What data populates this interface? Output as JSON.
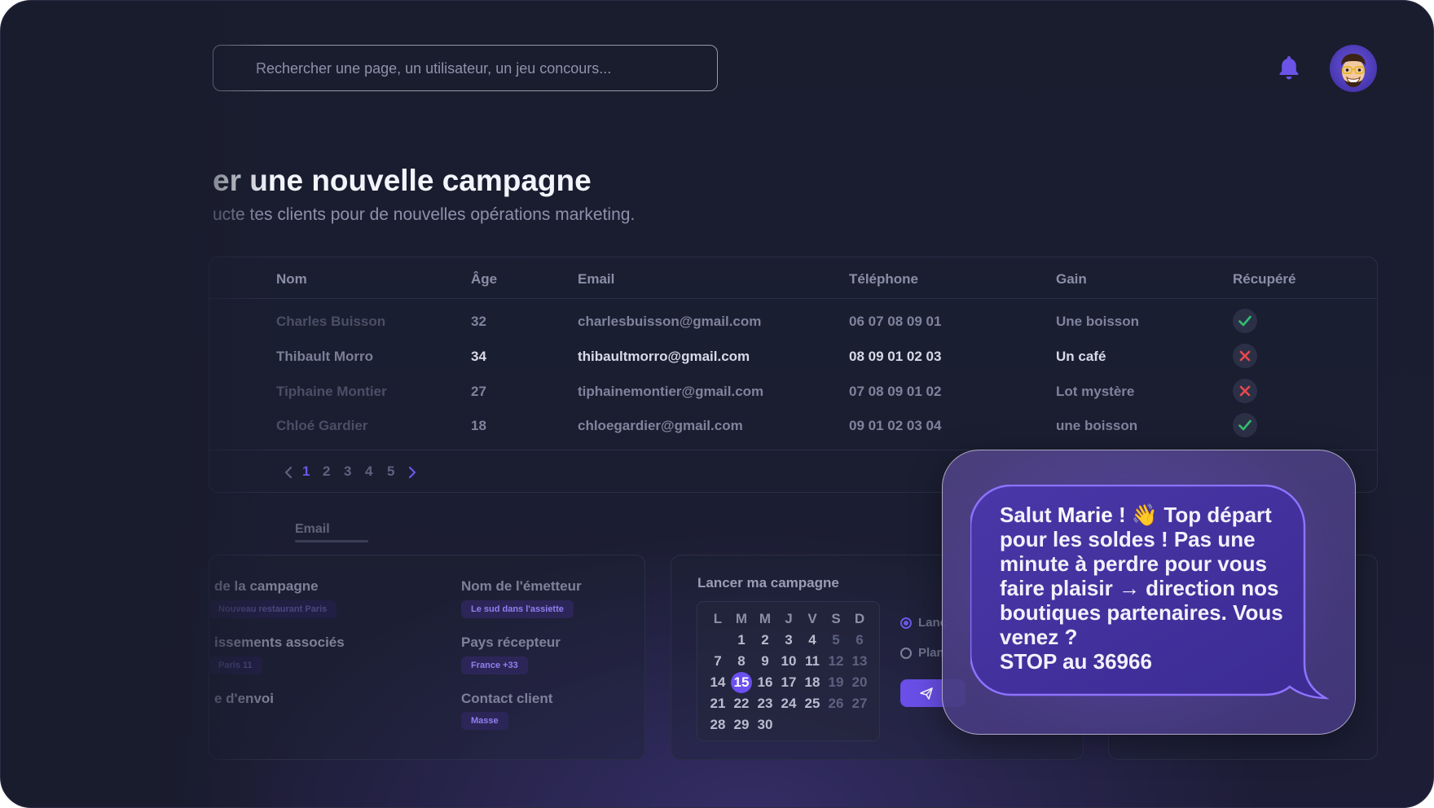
{
  "search": {
    "placeholder": "Rechercher une page, un utilisateur, un jeu concours..."
  },
  "header": {
    "notification_icon": "bell-icon",
    "avatar_icon": "memoji-avatar"
  },
  "page": {
    "title": "er une nouvelle campagne",
    "subtitle": "ucte tes clients pour de nouvelles opérations marketing."
  },
  "table": {
    "columns": [
      "Nom",
      "Âge",
      "Email",
      "Téléphone",
      "Gain",
      "Récupéré"
    ],
    "rows": [
      {
        "name": "Charles Buisson",
        "age": "32",
        "email": "charlesbuisson@gmail.com",
        "phone": "06 07 08 09 01",
        "gain": "Une boisson",
        "recovered": true
      },
      {
        "name": "Thibault Morro",
        "age": "34",
        "email": "thibaultmorro@gmail.com",
        "phone": "08 09 01 02 03",
        "gain": "Un café",
        "recovered": false
      },
      {
        "name": "Tiphaine Montier",
        "age": "27",
        "email": "tiphainemontier@gmail.com",
        "phone": "07 08 09 01 02",
        "gain": "Lot mystère",
        "recovered": false
      },
      {
        "name": "Chloé Gardier",
        "age": "18",
        "email": "chloegardier@gmail.com",
        "phone": "09 01 02 03 04",
        "gain": "une boisson",
        "recovered": true
      }
    ],
    "pagination": {
      "pages": [
        "1",
        "2",
        "3",
        "4",
        "5"
      ],
      "current": "1"
    }
  },
  "tabs": {
    "email": "Email"
  },
  "form": {
    "campaign_name_label": "de la campagne",
    "campaign_name_value": "Nouveau restaurant Paris",
    "establishments_label": "issements associés",
    "establishments_value": "Paris 11",
    "send_label": "e d'envoi",
    "sender_label": "Nom de l'émetteur",
    "sender_value": "Le sud dans l'assiette",
    "country_label": "Pays récepteur",
    "country_value": "France +33",
    "contact_label": "Contact client",
    "contact_value": "Masse"
  },
  "launch": {
    "title": "Lancer ma campagne",
    "weekdays": [
      "L",
      "M",
      "M",
      "J",
      "V",
      "S",
      "D"
    ],
    "selected_day": "15",
    "option_now": "Lanc",
    "option_plan": "Plan"
  },
  "popup": {
    "greeting": "Salut ",
    "name": "Marie",
    "wave_emoji": "👋",
    "body": " Top départ pour les soldes ! Pas une minute à perdre pour vous faire plaisir → direction nos boutiques partenaires. Vous venez ?",
    "stop": "STOP au 36966"
  },
  "colors": {
    "accent": "#6b57e8",
    "background": "#1b1d31",
    "check": "#2fbf71",
    "cross": "#e5484d"
  }
}
